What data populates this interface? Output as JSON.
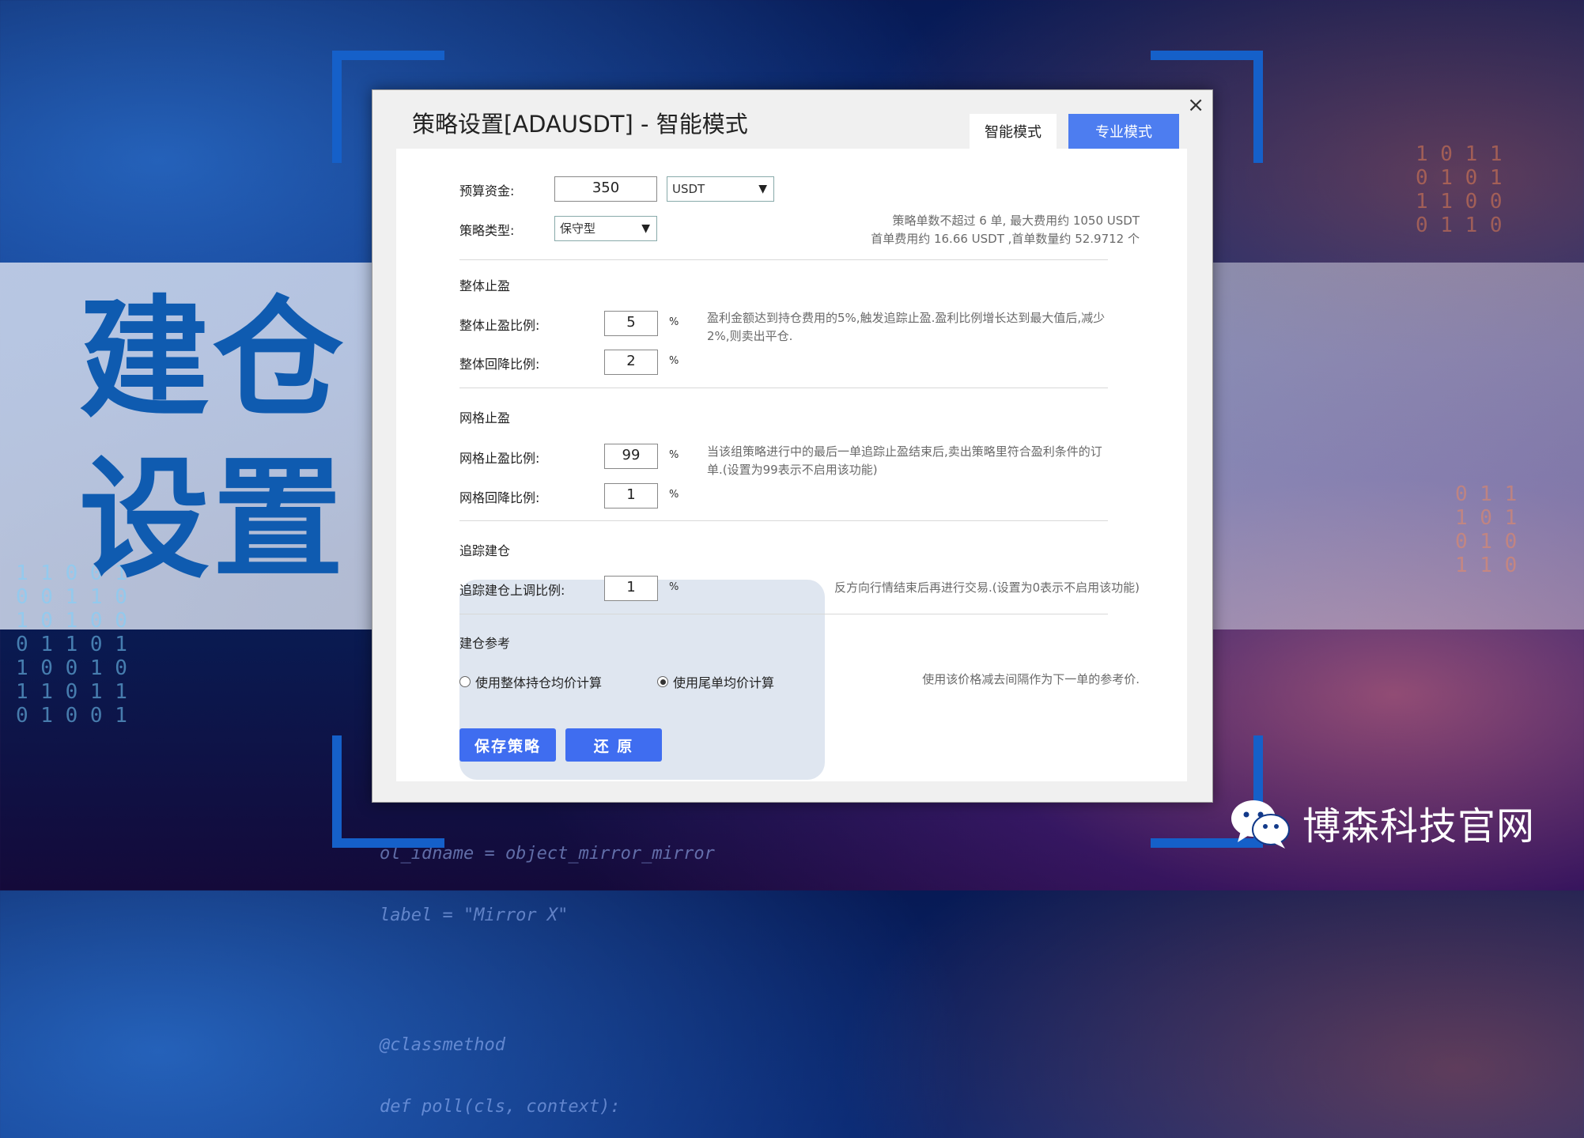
{
  "side_title": [
    "建仓",
    "设置"
  ],
  "brand": {
    "name": "博森科技官网",
    "icon": "wechat-icon"
  },
  "background_code": [
    "ol_idname = object_mirror_mirror",
    "label = \"Mirror X\"",
    "@classmethod",
    "def poll(cls, context):"
  ],
  "dialog": {
    "title": "策略设置[ADAUSDT] - 智能模式",
    "close": "×",
    "tabs": {
      "smart": "智能模式",
      "pro": "专业模式"
    },
    "budget": {
      "label": "预算资金:",
      "value": "350",
      "currency": "USDT"
    },
    "strategy_type": {
      "label": "策略类型:",
      "value": "保守型"
    },
    "summary": [
      "策略单数不超过 6 单, 最大费用约 1050 USDT",
      "首单费用约 16.66 USDT ,首单数量约 52.9712 个"
    ],
    "overall_tp": {
      "section": "整体止盈",
      "ratio_label": "整体止盈比例:",
      "ratio_value": "5",
      "pullback_label": "整体回降比例:",
      "pullback_value": "2",
      "unit": "%",
      "note": [
        "盈利金额达到持仓费用的5%,触发追踪止盈.盈利比例增长达到最大值后,减少",
        "2%,则卖出平仓."
      ]
    },
    "grid_tp": {
      "section": "网格止盈",
      "ratio_label": "网格止盈比例:",
      "ratio_value": "99",
      "pullback_label": "网格回降比例:",
      "pullback_value": "1",
      "unit": "%",
      "note": [
        "当该组策略进行中的最后一单追踪止盈结束后,卖出策略里符合盈利条件的订",
        "单.(设置为99表示不启用该功能)"
      ]
    },
    "trailing_entry": {
      "section": "追踪建仓",
      "label": "追踪建仓上调比例:",
      "value": "1",
      "unit": "%",
      "note": "反方向行情结束后再进行交易.(设置为0表示不启用该功能)"
    },
    "entry_ref": {
      "section": "建仓参考",
      "option_1": "使用整体持仓均价计算",
      "option_2": "使用尾单均价计算",
      "selected": "使用尾单均价计算",
      "note": "使用该价格减去间隔作为下一单的参考价."
    },
    "buttons": {
      "save": "保存策略",
      "reset": "还 原"
    }
  },
  "colors": {
    "accent": "#3f6df0",
    "title_blue": "#0f5bb0"
  }
}
